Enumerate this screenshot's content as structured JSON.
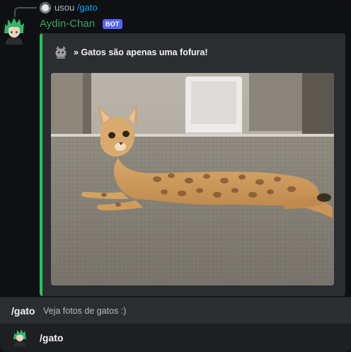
{
  "reply": {
    "prefix": "usou",
    "command": "/gato"
  },
  "message": {
    "username": "Aydin-Chan",
    "badge": "BOT",
    "username_color": "#3ba55c"
  },
  "embed": {
    "accent_color": "#22c55e",
    "title_icon": "cat-icon",
    "title": "» Gatos são apenas uma fofura!",
    "image_subject": "cat-photo"
  },
  "command_preview": {
    "name": "/gato",
    "description": "Veja fotos de gatos :)"
  },
  "command_option": {
    "label": "/gato"
  }
}
